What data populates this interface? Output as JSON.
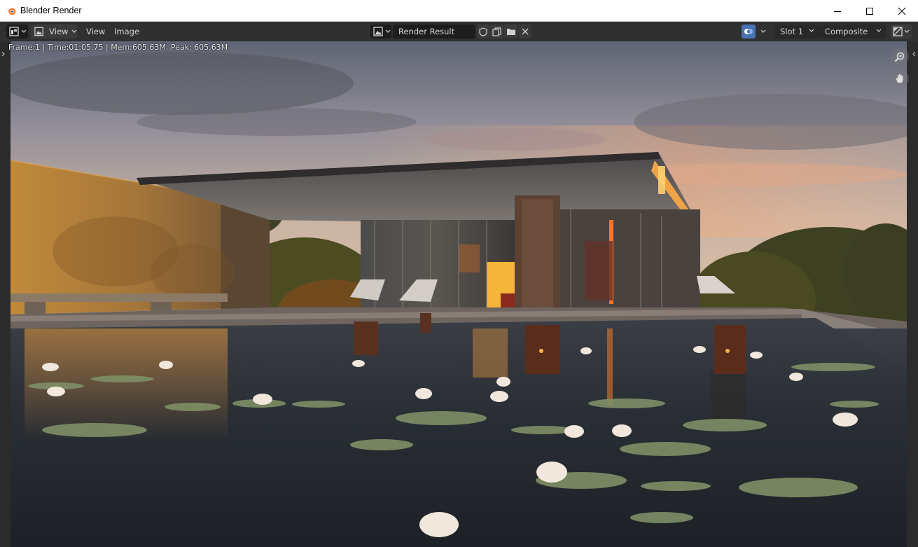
{
  "window": {
    "title": "Blender Render",
    "controls": [
      "minimize",
      "maximize",
      "close"
    ]
  },
  "header": {
    "editor_type_icon": "image-editor-icon",
    "view_mode_icon": "image-view-icon",
    "view_mode_label": "View",
    "menus": [
      "View",
      "Image"
    ],
    "image_name": "Render Result",
    "image_actions": [
      "fake-user-icon",
      "new-image-icon",
      "open-image-icon",
      "unlink-icon"
    ],
    "display_channels_icon": "display-channels-icon",
    "slot": "Slot 1",
    "layer": "Composite",
    "gizmo_icon": "gizmo-toggle-icon"
  },
  "viewport": {
    "render_info": "Frame:1 | Time:01:05.75 | Mem:605.63M, Peak: 605.63M",
    "nav_buttons": [
      "zoom-icon",
      "pan-hand-icon"
    ]
  },
  "colors": {
    "header_bg": "#303030",
    "field_bg": "#1d1d1d",
    "accent_blue": "#4772b3",
    "sky_top": "#6a6f7c",
    "sunset_orange": "#f0a060",
    "water_dark": "#20252a"
  }
}
